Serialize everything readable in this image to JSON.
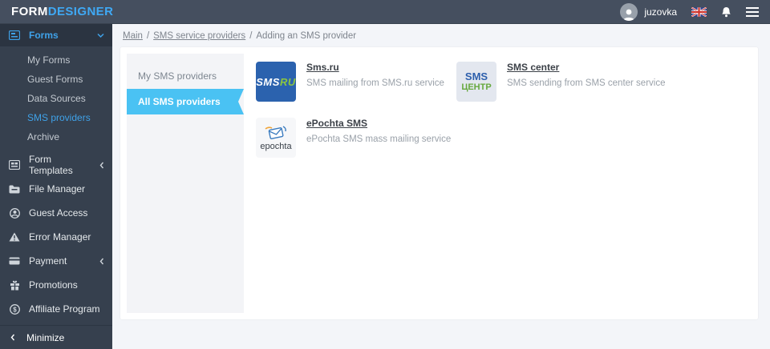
{
  "colors": {
    "topbar_bg": "#454f5f",
    "sidebar_bg": "#36404e",
    "sidebar_active_bg": "#2b3441",
    "accent_blue": "#3fa2e9",
    "logo_blue": "#3fa9f5",
    "tab_active_bg": "#4ac2f3",
    "smsru_logo_bg": "#2b62ae",
    "smsru_green": "#8dc63f",
    "page_bg": "#f3f5f9"
  },
  "topbar": {
    "logo_primary": "FORM",
    "logo_secondary": "DESIGNER",
    "username": "juzovka",
    "icons": [
      "avatar",
      "uk-flag-icon",
      "bell-icon",
      "hamburger-icon"
    ]
  },
  "sidebar": {
    "forms_group": {
      "label": "Forms",
      "icon": "forms-icon",
      "state": "expanded"
    },
    "forms_children": [
      {
        "label": "My Forms",
        "active": false
      },
      {
        "label": "Guest Forms",
        "active": false
      },
      {
        "label": "Data Sources",
        "active": false
      },
      {
        "label": "SMS providers",
        "active": true
      },
      {
        "label": "Archive",
        "active": false
      }
    ],
    "items": [
      {
        "label": "Form Templates",
        "icon": "form-templates-icon",
        "chevron": "collapsed"
      },
      {
        "label": "File Manager",
        "icon": "file-manager-icon",
        "chevron": ""
      },
      {
        "label": "Guest Access",
        "icon": "guest-access-icon",
        "chevron": ""
      },
      {
        "label": "Error Manager",
        "icon": "error-manager-icon",
        "chevron": ""
      },
      {
        "label": "Payment",
        "icon": "payment-icon",
        "chevron": "collapsed"
      },
      {
        "label": "Promotions",
        "icon": "promotions-icon",
        "chevron": ""
      },
      {
        "label": "Affiliate Program",
        "icon": "affiliate-icon",
        "chevron": ""
      }
    ],
    "minimize_label": "Minimize"
  },
  "breadcrumb": {
    "separator": "/",
    "items": [
      {
        "label": "Main",
        "link": true
      },
      {
        "label": "SMS service providers",
        "link": true
      },
      {
        "label": "Adding an SMS provider",
        "link": false
      }
    ]
  },
  "tabs": [
    {
      "label": "My SMS providers",
      "active": false
    },
    {
      "label": "All SMS providers",
      "active": true
    }
  ],
  "providers": [
    {
      "name": "Sms.ru",
      "description": "SMS mailing from SMS.ru service",
      "logo": {
        "part1": "SMS",
        "part2": "RU"
      }
    },
    {
      "name": "SMS center",
      "description": "SMS sending from SMS center service",
      "logo": {
        "line1": "SMS",
        "line2": "ЦЕНТР"
      }
    },
    {
      "name": "ePochta SMS",
      "description": "ePochta SMS mass mailing service",
      "logo": {
        "text": "epochta"
      }
    }
  ]
}
